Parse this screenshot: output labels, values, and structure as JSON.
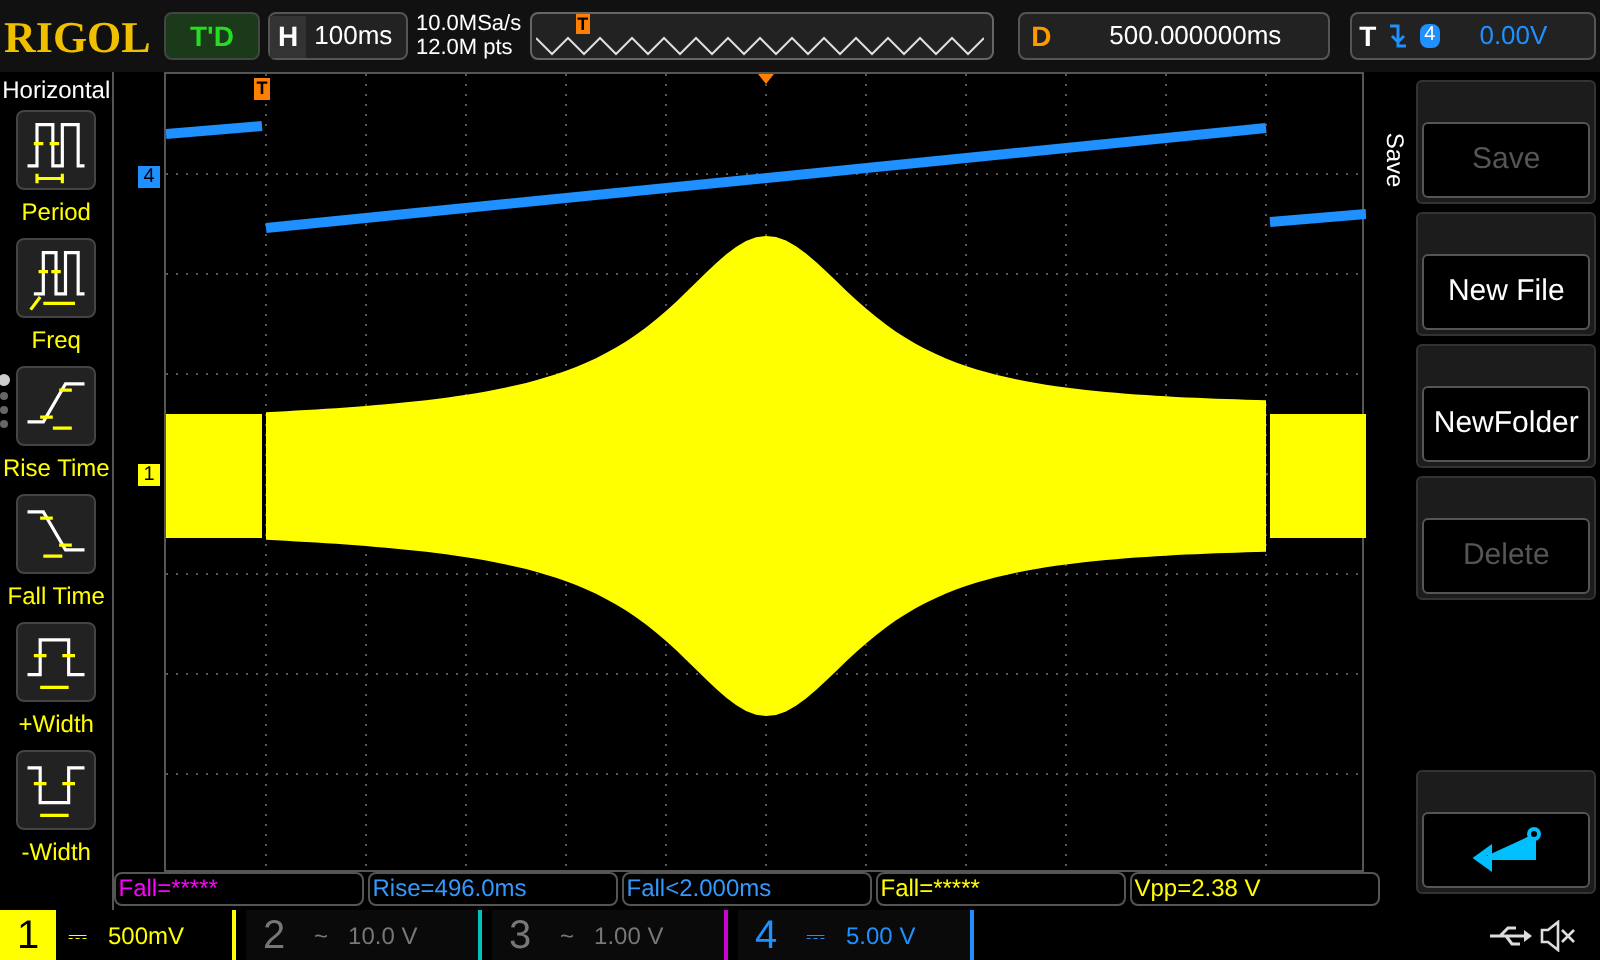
{
  "top_bar": {
    "logo": "RIGOL",
    "run_status": "T'D",
    "horizontal": {
      "label": "H",
      "value": "100ms"
    },
    "sample_rate": "10.0MSa/s",
    "memory_depth": "12.0M pts",
    "overview_marker": "T",
    "delay": {
      "label": "D",
      "value": "500.000000ms"
    },
    "trigger": {
      "label": "T",
      "source": "4",
      "level": "0.00V"
    }
  },
  "left_menu": {
    "title": "Horizontal",
    "pages": [
      {
        "selected": true
      },
      {
        "selected": false
      },
      {
        "selected": false
      },
      {
        "selected": false
      }
    ],
    "items": [
      {
        "kind": "period",
        "label": "Period"
      },
      {
        "kind": "freq",
        "label": "Freq"
      },
      {
        "kind": "rise",
        "label": "Rise Time"
      },
      {
        "kind": "fall",
        "label": "Fall Time"
      },
      {
        "kind": "pwidth",
        "label": "+Width"
      },
      {
        "kind": "nwidth",
        "label": "-Width"
      }
    ]
  },
  "waveform": {
    "trigger_marker": "T",
    "channel_markers": [
      {
        "label": "4",
        "color": "#1e90ff"
      },
      {
        "label": "1",
        "color": "#ffff00"
      }
    ]
  },
  "measurements": [
    {
      "text": "Fall=*****",
      "color": "#ff00ff"
    },
    {
      "text": "Rise=496.0ms",
      "color": "#3399ff"
    },
    {
      "text": "Fall<2.000ms",
      "color": "#3399ff"
    },
    {
      "text": "Fall=*****",
      "color": "#ffff00"
    },
    {
      "text": "Vpp=2.38 V",
      "color": "#ffff00"
    }
  ],
  "channels": [
    {
      "number": "1",
      "coupling": "⎓",
      "scale": "500mV",
      "on": true,
      "selected": true,
      "color": "#ffff00"
    },
    {
      "number": "2",
      "coupling": "~",
      "scale": "10.0 V",
      "on": false,
      "selected": false,
      "color": "#00c0c0"
    },
    {
      "number": "3",
      "coupling": "~",
      "scale": "1.00 V",
      "on": false,
      "selected": false,
      "color": "#d000d0"
    },
    {
      "number": "4",
      "coupling": "⎓",
      "scale": "5.00 V",
      "on": true,
      "selected": false,
      "color": "#1e90ff"
    }
  ],
  "softkeys": {
    "title": "Save",
    "items": [
      {
        "label": "Save",
        "disabled": true
      },
      {
        "label": "New File",
        "disabled": false
      },
      {
        "label": "NewFolder",
        "disabled": false
      },
      {
        "label": "Delete",
        "disabled": true
      }
    ]
  }
}
